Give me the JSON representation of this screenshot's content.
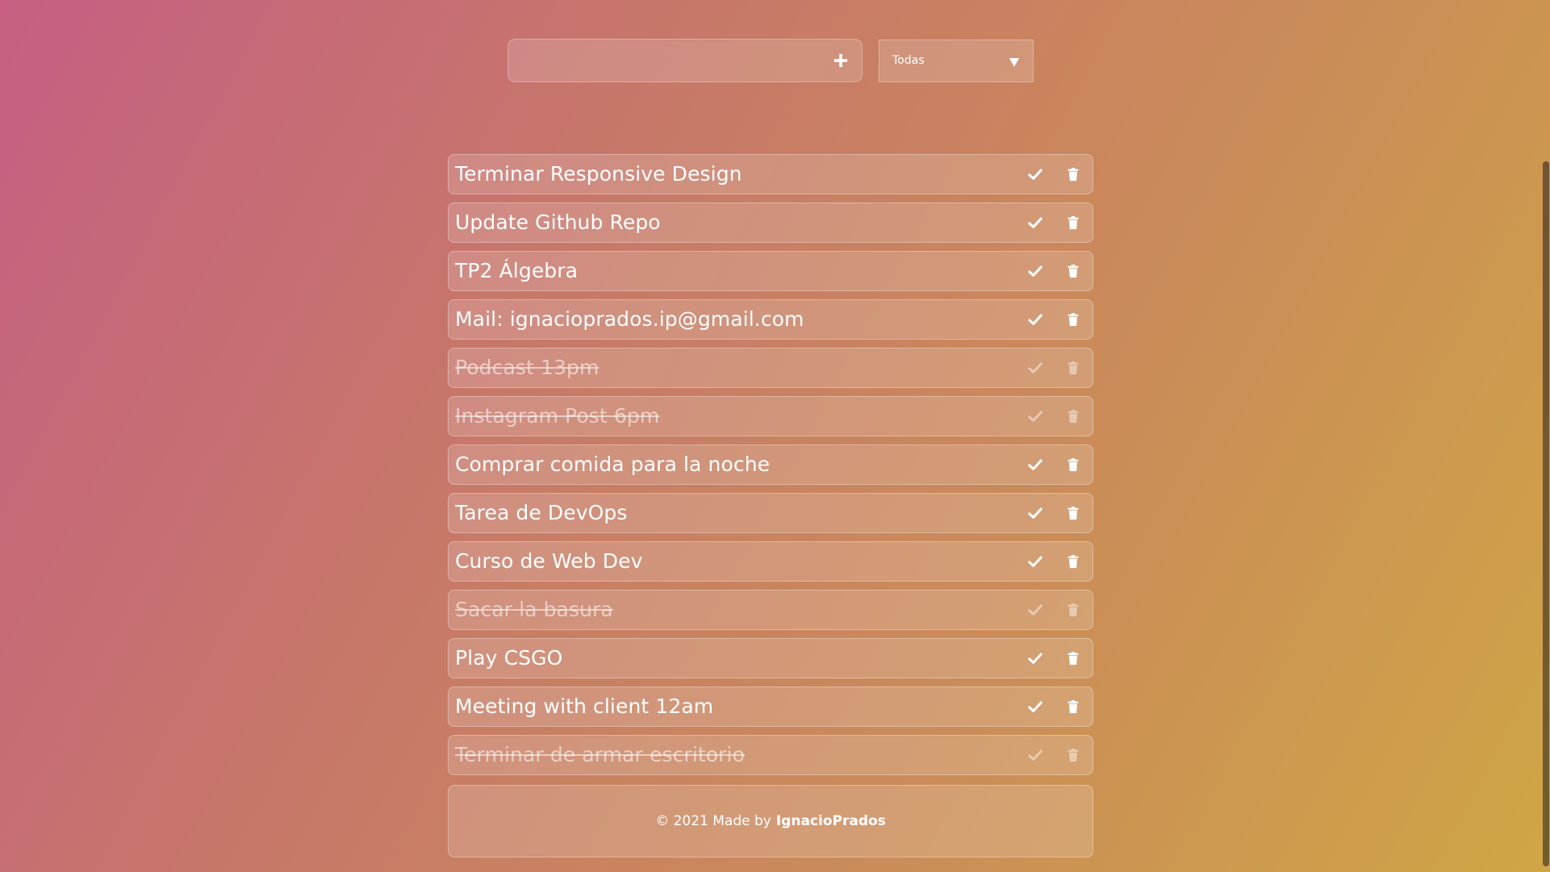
{
  "add_form": {
    "input_value": "",
    "input_placeholder": "",
    "add_icon": "plus-icon"
  },
  "filter": {
    "selected": "Todas",
    "caret_icon": "caret-down-icon"
  },
  "todos": [
    {
      "text": "Terminar Responsive Design",
      "completed": false
    },
    {
      "text": "Update Github Repo",
      "completed": false
    },
    {
      "text": "TP2 Álgebra",
      "completed": false
    },
    {
      "text": "Mail: ignacioprados.ip@gmail.com",
      "completed": false
    },
    {
      "text": "Podcast 13pm",
      "completed": true
    },
    {
      "text": "Instagram Post 6pm",
      "completed": true
    },
    {
      "text": "Comprar comida para la noche",
      "completed": false
    },
    {
      "text": "Tarea de DevOps",
      "completed": false
    },
    {
      "text": "Curso de Web Dev",
      "completed": false
    },
    {
      "text": "Sacar la basura",
      "completed": true
    },
    {
      "text": "Play CSGO",
      "completed": false
    },
    {
      "text": "Meeting with client 12am",
      "completed": false
    },
    {
      "text": "Terminar de armar escritorio",
      "completed": true
    }
  ],
  "todo_icons": {
    "complete": "check-icon",
    "delete": "trash-icon"
  },
  "footer": {
    "prefix": "© 2021 Made by",
    "author": "IgnacioPrados"
  },
  "colors": {
    "gradient_start": "#c65f82",
    "gradient_end": "#cfa645",
    "text": "#ffffff"
  }
}
